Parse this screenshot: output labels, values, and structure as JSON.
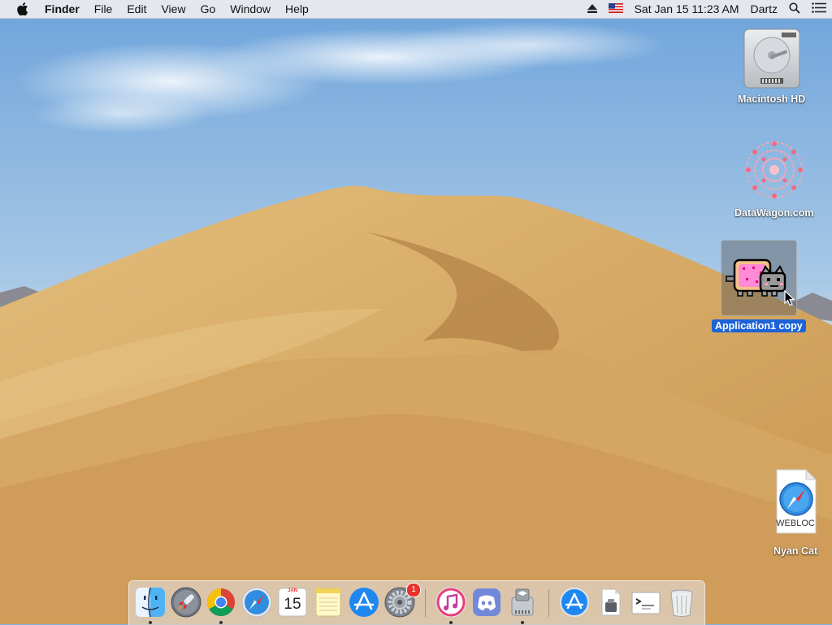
{
  "menubar": {
    "app_name": "Finder",
    "menus": [
      "File",
      "Edit",
      "View",
      "Go",
      "Window",
      "Help"
    ],
    "datetime": "Sat Jan 15  11:23 AM",
    "user": "Dartz"
  },
  "desktop": {
    "icons": {
      "macintosh_hd": "Macintosh HD",
      "datawagon": "DataWagon.com",
      "application_copy": "Application1 copy",
      "nyan_cat": "Nyan Cat",
      "webloc_badge": "WEBLOC"
    }
  },
  "dock": {
    "calendar_month": "JAN",
    "calendar_day": "15",
    "system_prefs_badge": "1",
    "items": [
      "Finder",
      "Launchpad",
      "Google Chrome",
      "Safari",
      "Calendar",
      "Notes",
      "App Store",
      "System Preferences",
      "iTunes",
      "Discord",
      "Boot Camp Assistant",
      "App Store",
      "Document",
      "Terminal",
      "Trash"
    ]
  },
  "colors": {
    "selection": "#1d63d8",
    "badge": "#e8322e",
    "sky_top": "#6ea4db",
    "sand": "#d4a862"
  }
}
